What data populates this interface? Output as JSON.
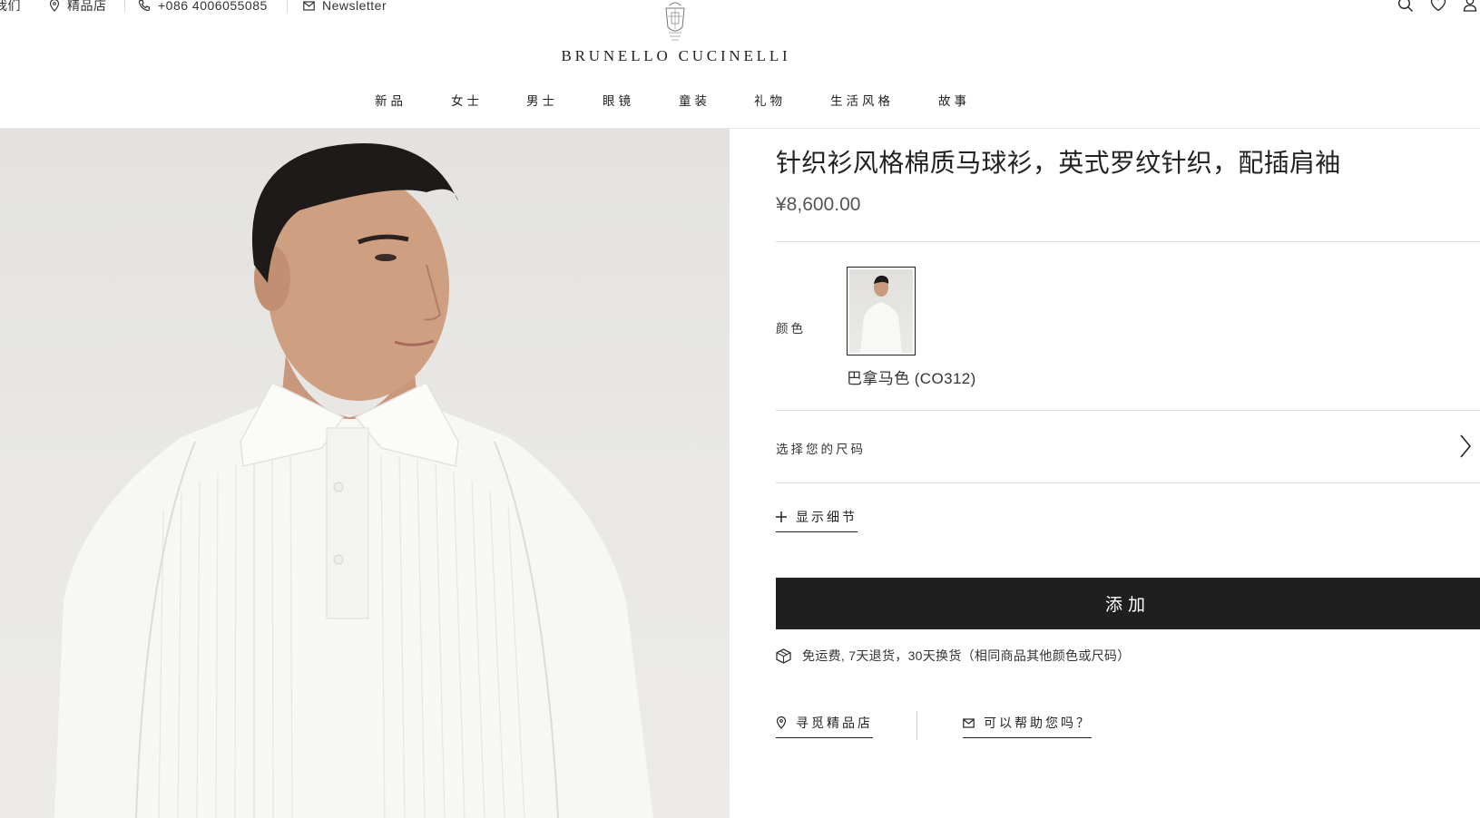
{
  "header": {
    "utility": {
      "contact_partial": "我们",
      "stores": "精品店",
      "phone": "+086 4006055085",
      "newsletter": "Newsletter"
    },
    "brand": "BRUNELLO CUCINELLI",
    "nav": [
      "新品",
      "女士",
      "男士",
      "眼镜",
      "童装",
      "礼物",
      "生活风格",
      "故事"
    ]
  },
  "product": {
    "title": "针织衫风格棉质马球衫，英式罗纹针织，配插肩袖",
    "price": "¥8,600.00",
    "color_label": "颜色",
    "color_name": "巴拿马色 (CO312)",
    "size_label": "选择您的尺码",
    "details_label": "显示细节",
    "add_label": "添加",
    "shipping_note": "免运费, 7天退货，30天换货（相同商品其他颜色或尺码）",
    "find_store": "寻觅精品店",
    "help": "可以帮助您吗？"
  },
  "icons": [
    "location-pin-icon",
    "phone-icon",
    "mail-icon",
    "search-icon",
    "heart-icon",
    "user-icon",
    "chevron-right-icon",
    "plus-icon",
    "package-icon"
  ],
  "colors": {
    "button_bg": "#1f1f1f",
    "text": "#222222",
    "divider": "#dcdcdc",
    "hero_bg": "#e6e5e1"
  }
}
